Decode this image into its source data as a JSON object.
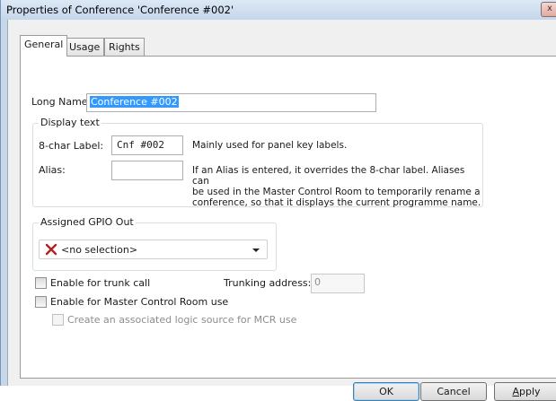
{
  "window": {
    "title": "Properties of Conference 'Conference #002'",
    "close_glyph": "x"
  },
  "tabs": [
    {
      "label": "General",
      "active": true
    },
    {
      "label": "Usage",
      "active": false
    },
    {
      "label": "Rights",
      "active": false
    }
  ],
  "general": {
    "long_name_label": "Long Name:",
    "long_name_value": "Conference #002",
    "display_text": {
      "title": "Display text",
      "label_8char_label": "8-char Label:",
      "label_8char_value": "Cnf #002",
      "label_8char_note": "Mainly used for panel key labels.",
      "alias_label": "Alias:",
      "alias_value": "",
      "alias_note_lines": [
        "If an Alias is entered, it overrides the 8-char label. Aliases can",
        "be used in the Master Control Room to temporarily rename a",
        "conference, so that it displays the current programme name."
      ]
    },
    "gpio": {
      "title": "Assigned GPIO Out",
      "selected": "<no selection>",
      "icon": "red-x-icon",
      "icon_color": "#b22222"
    },
    "trunk": {
      "checkbox_label": "Enable for trunk call",
      "checked": false,
      "address_label": "Trunking address:",
      "address_value": "0"
    },
    "mcr": {
      "checkbox_label": "Enable for Master Control Room use",
      "checked": false,
      "logic_label": "Create an associated logic source for MCR use",
      "logic_checked": false,
      "logic_enabled": false
    }
  },
  "buttons": {
    "ok": "OK",
    "cancel": "Cancel",
    "apply_first": "A",
    "apply_rest": "pply"
  }
}
